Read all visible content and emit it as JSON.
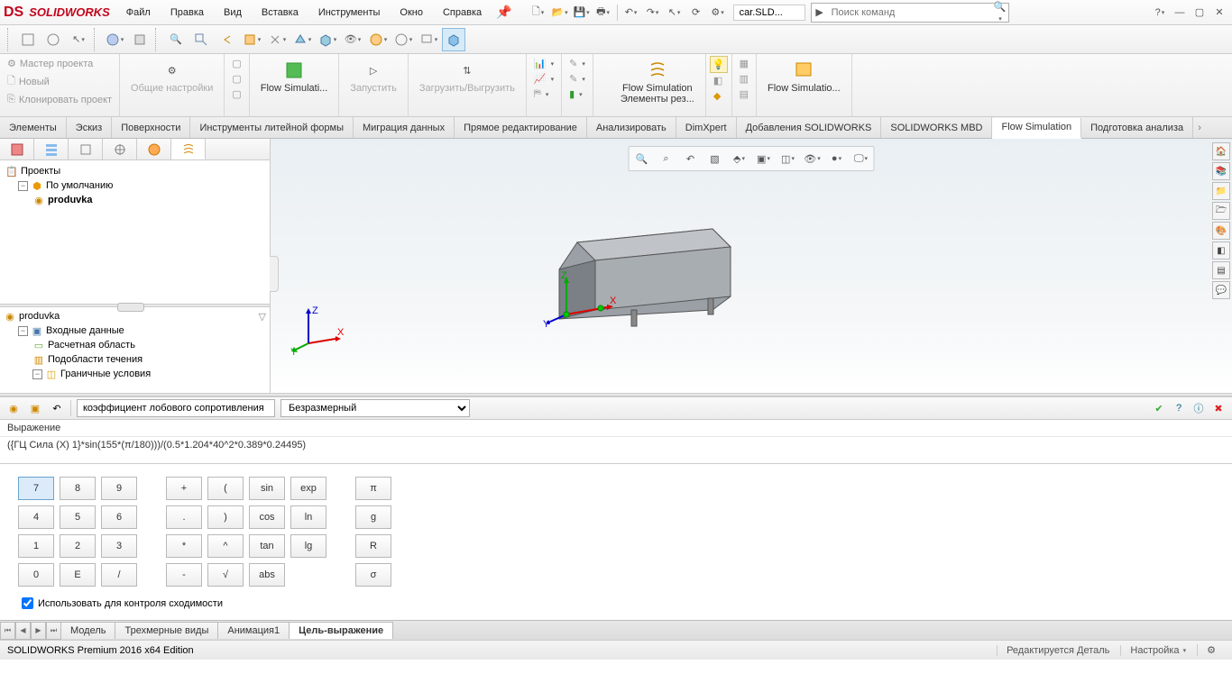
{
  "app": {
    "name": "SOLIDWORKS",
    "logo_prefix": "DS"
  },
  "menu": [
    "Файл",
    "Правка",
    "Вид",
    "Вставка",
    "Инструменты",
    "Окно",
    "Справка"
  ],
  "doc_name": "car.SLD...",
  "search_placeholder": "Поиск команд",
  "ribbon_left": {
    "master": "Мастер проекта",
    "new": "Новый",
    "clone": "Клонировать проект",
    "general": "Общие настройки",
    "flowsim": "Flow Simulati...",
    "run": "Запустить",
    "loadunload": "Загрузить/Выгрузить"
  },
  "ribbon_right": {
    "flowsim": "Flow Simulation",
    "elements": "Элементы рез...",
    "flowsim2": "Flow Simulatio..."
  },
  "cm_tabs": [
    "Элементы",
    "Эскиз",
    "Поверхности",
    "Инструменты литейной формы",
    "Миграция данных",
    "Прямое редактирование",
    "Анализировать",
    "DimXpert",
    "Добавления SOLIDWORKS",
    "SOLIDWORKS MBD",
    "Flow Simulation",
    "Подготовка анализа"
  ],
  "cm_active": 10,
  "fm_tree": {
    "root": "Проекты",
    "default": "По умолчанию",
    "project": "produvka"
  },
  "study_tree": {
    "name": "produvka",
    "input": "Входные данные",
    "comp_domain": "Расчетная область",
    "fluid_sub": "Подобласти течения",
    "boundary": "Граничные условия"
  },
  "goal": {
    "name_value": "коэффициент лобового сопротивления",
    "dimension": "Безразмерный",
    "expr_label": "Выражение",
    "expr_value": "({ГЦ Сила (X) 1}*sin(155*(π/180)))/(0.5*1.204*40^2*0.389*0.24495)",
    "use_for_conv": "Использовать для контроля сходимости"
  },
  "calc": {
    "r1": [
      "7",
      "8",
      "9"
    ],
    "r1b": [
      "+",
      "(",
      "sin",
      "exp"
    ],
    "r1c": [
      "π"
    ],
    "r2": [
      "4",
      "5",
      "6"
    ],
    "r2b": [
      ".",
      ")",
      "cos",
      "ln"
    ],
    "r2c": [
      "g"
    ],
    "r3": [
      "1",
      "2",
      "3"
    ],
    "r3b": [
      "*",
      "^",
      "tan",
      "lg"
    ],
    "r3c": [
      "R"
    ],
    "r4": [
      "0",
      "E",
      "/"
    ],
    "r4b": [
      "-",
      "√",
      "abs",
      ""
    ],
    "r4c": [
      "σ"
    ],
    "active": "7"
  },
  "bottom_tabs": [
    "Модель",
    "Трехмерные виды",
    "Анимация1",
    "Цель-выражение"
  ],
  "bottom_active": 3,
  "status": {
    "left": "SOLIDWORKS Premium 2016 x64 Edition",
    "edit": "Редактируется Деталь",
    "custom": "Настройка"
  },
  "triad": {
    "x": "X",
    "y": "Y",
    "z": "Z"
  }
}
